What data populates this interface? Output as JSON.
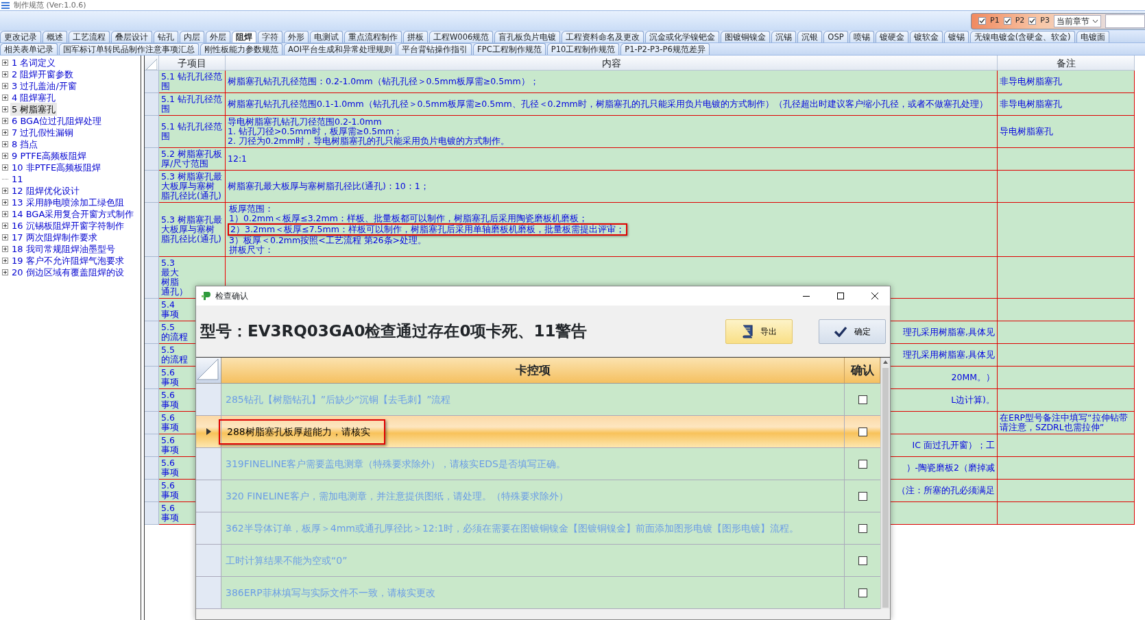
{
  "window": {
    "title": "制作规范 (Ver:1.0.6)"
  },
  "filter": {
    "options": [
      {
        "label": "P1",
        "checked": true
      },
      {
        "label": "P2",
        "checked": true
      },
      {
        "label": "P3",
        "checked": true
      }
    ],
    "scope": "当前章节"
  },
  "tab_rows": [
    [
      {
        "label": "更改记录",
        "selected": false
      },
      {
        "label": "概述",
        "selected": false
      },
      {
        "label": "工艺流程",
        "selected": false
      },
      {
        "label": "叠层设计",
        "selected": false
      },
      {
        "label": "钻孔",
        "selected": false
      },
      {
        "label": "内层",
        "selected": false
      },
      {
        "label": "外层",
        "selected": false
      },
      {
        "label": "阻焊",
        "selected": true
      },
      {
        "label": "字符",
        "selected": false
      },
      {
        "label": "外形",
        "selected": false
      },
      {
        "label": "电测试",
        "selected": false
      },
      {
        "label": "重点流程制作",
        "selected": false
      },
      {
        "label": "拼板",
        "selected": false
      },
      {
        "label": "工程W006规范",
        "selected": false
      },
      {
        "label": "盲孔板负片电镀",
        "selected": false
      },
      {
        "label": "工程资料命名及更改",
        "selected": false
      },
      {
        "label": "沉金或化学镍钯金",
        "selected": false
      },
      {
        "label": "图镀铜镍金",
        "selected": false
      },
      {
        "label": "沉锡",
        "selected": false
      },
      {
        "label": "沉银",
        "selected": false
      },
      {
        "label": "OSP",
        "selected": false
      },
      {
        "label": "喷锡",
        "selected": false
      },
      {
        "label": "镀硬金",
        "selected": false
      },
      {
        "label": "镀软金",
        "selected": false
      },
      {
        "label": "镀锡",
        "selected": false
      },
      {
        "label": "无镍电镀金(含硬金、软金)",
        "selected": false
      },
      {
        "label": "电镀面",
        "selected": false
      }
    ],
    [
      {
        "label": "相关表单记录",
        "selected": false
      },
      {
        "label": "国军标订单转民品制作注意事项汇总",
        "selected": false
      },
      {
        "label": "刚性板能力参数规范",
        "selected": false
      },
      {
        "label": "AOI平台生成和异常处理规则",
        "selected": false
      },
      {
        "label": "平台背钻操作指引",
        "selected": false
      },
      {
        "label": "FPC工程制作规范",
        "selected": false
      },
      {
        "label": "P10工程制作规范",
        "selected": false
      },
      {
        "label": "P1-P2-P3-P6规范差异",
        "selected": false
      }
    ]
  ],
  "tree": [
    {
      "label": "1  名词定义",
      "expandable": true,
      "selected": false
    },
    {
      "label": "2  阻焊开窗参数",
      "expandable": true,
      "selected": false
    },
    {
      "label": "3  过孔盖油/开窗",
      "expandable": true,
      "selected": false
    },
    {
      "label": "4  阻焊塞孔",
      "expandable": true,
      "selected": false
    },
    {
      "label": "5  树脂塞孔",
      "expandable": true,
      "selected": true
    },
    {
      "label": "6  BGA位过孔阻焊处理",
      "expandable": true,
      "selected": false
    },
    {
      "label": "7  过孔假性漏铜",
      "expandable": true,
      "selected": false
    },
    {
      "label": "8  挡点",
      "expandable": true,
      "selected": false
    },
    {
      "label": "9  PTFE高频板阻焊",
      "expandable": true,
      "selected": false
    },
    {
      "label": "10  非PTFE高频板阻焊",
      "expandable": true,
      "selected": false
    },
    {
      "label": "11",
      "expandable": false,
      "selected": false
    },
    {
      "label": "12  阻焊优化设计",
      "expandable": true,
      "selected": false
    },
    {
      "label": "13  采用静电喷涂加工绿色阻",
      "expandable": true,
      "selected": false
    },
    {
      "label": "14  BGA采用复合开窗方式制作",
      "expandable": true,
      "selected": false
    },
    {
      "label": "16  沉锡板阻焊开窗字符制作",
      "expandable": true,
      "selected": false
    },
    {
      "label": "17  两次阻焊制作要求",
      "expandable": true,
      "selected": false
    },
    {
      "label": "18  我司常规阻焊油墨型号",
      "expandable": true,
      "selected": false
    },
    {
      "label": "19  客户不允许阻焊气泡要求",
      "expandable": true,
      "selected": false
    },
    {
      "label": "20  倒边区域有覆盖阻焊的设",
      "expandable": true,
      "selected": false
    }
  ],
  "grid": {
    "columns": [
      "子项目",
      "内容",
      "备注"
    ],
    "rows": [
      {
        "subitem": "5.1 钻孔孔径范围",
        "content": "树脂塞孔钻孔孔径范围：0.2-1.0mm（钻孔孔径＞0.5mm板厚需≥0.5mm）；",
        "remark": "非导电树脂塞孔"
      },
      {
        "subitem": "5.1 钻孔孔径范围",
        "content": "树脂塞孔钻孔孔径范围0.1-1.0mm（钻孔孔径＞0.5mm板厚需≥0.5mm、孔径＜0.2mm时，树脂塞孔的孔只能采用负片电镀的方式制作）（孔径超出时建议客户缩小孔径，或者不做塞孔处理）",
        "remark": "非导电树脂塞孔"
      },
      {
        "subitem": "5.1 钻孔孔径范围",
        "content": "导电树脂塞孔钻孔刀径范围0.2-1.0mm\n1.  钻孔刀径>0.5mm时，板厚需≥0.5mm；\n2.  刀径为0.2mm时，导电树脂塞孔的孔只能采用负片电镀的方式制作。",
        "remark": "导电树脂塞孔"
      },
      {
        "subitem": "5.2 树脂塞孔板厚/尺寸范围",
        "content": "12:1"
      },
      {
        "subitem": "5.3 树脂塞孔最大板厚与塞树脂孔径比(通孔)",
        "content": "树脂塞孔最大板厚与塞树脂孔径比(通孔)：10：1；"
      },
      {
        "subitem": "5.3 树脂塞孔最大板厚与塞树脂孔径比(通孔)",
        "content": [
          {
            "text": "板厚范围：",
            "highlighted": false
          },
          {
            "text": "1）0.2mm＜板厚≤3.2mm：样板、批量板都可以制作，树脂塞孔后采用陶瓷磨板机磨板；",
            "highlighted": false
          },
          {
            "text": "2）3.2mm＜板厚≤7.5mm：样板可以制作，树脂塞孔后采用单轴磨板机磨板，批量板需提出评审；",
            "highlighted": true
          },
          {
            "text": "3）板厚＜0.2mm按照<工艺流程  第26条>处理。",
            "highlighted": false
          },
          {
            "text": "拼板尺寸：",
            "highlighted": false
          }
        ]
      },
      {
        "subitem": [
          "5.3",
          "最大",
          "树脂",
          "通孔）"
        ]
      },
      {
        "subitem": [
          "5.4",
          "事项"
        ]
      },
      {
        "subitem": [
          "5.5",
          "的流程"
        ],
        "content": "理孔采用树脂塞,具体见"
      },
      {
        "subitem": [
          "5.5",
          "的流程"
        ],
        "content": "理孔采用树脂塞,具体见"
      },
      {
        "subitem": [
          "5.6",
          "事项"
        ],
        "content": "20MM。）"
      },
      {
        "subitem": [
          "5.6",
          "事项"
        ],
        "content": "L边计算)。"
      },
      {
        "subitem": [
          "5.6",
          "事项"
        ],
        "remark": "在ERP型号备注中填写“拉伸钻带请注意，SZDRL也需拉伸”"
      },
      {
        "subitem": [
          "5.6",
          "事项"
        ],
        "content": "IC 面过孔开窗）；工"
      },
      {
        "subitem": [
          "5.6",
          "事项"
        ],
        "content": "）-陶瓷磨板2（磨掉减"
      },
      {
        "subitem": [
          "5.6",
          "事项"
        ],
        "content": "（注：所塞的孔必须满足"
      },
      {
        "subitem": [
          "5.6",
          "事项"
        ]
      }
    ]
  },
  "dialog": {
    "title": "检查确认",
    "heading": "型号：EV3RQ03GA0检查通过存在0项卡死、11警告",
    "buttons": [
      {
        "kind": "export",
        "label": "导出"
      },
      {
        "kind": "confirm",
        "label": "确定"
      }
    ],
    "columns": [
      "卡控项",
      "确认"
    ],
    "rows": [
      {
        "text": "285钻孔【树脂钻孔】”后缺少“沉铜【去毛刺】”流程",
        "selected": false,
        "highlighted": false,
        "checked": false
      },
      {
        "text": "288树脂塞孔板厚超能力，请核实",
        "selected": true,
        "highlighted": true,
        "checked": false
      },
      {
        "text": "319FINELINE客户需要盖电测章（特殊要求除外），请核实EDS是否填写正确。",
        "selected": false,
        "highlighted": false,
        "checked": false
      },
      {
        "text": "320 FINELINE客户，需加电测章，并注意提供图纸，请处理。（特殊要求除外）",
        "selected": false,
        "highlighted": false,
        "checked": false
      },
      {
        "text": "362半导体订单，板厚＞4mm或通孔厚径比＞12:1时，必须在需要在图镀铜镍金【图镀铜镍金】前面添加图形电镀【图形电镀】流程。",
        "selected": false,
        "highlighted": false,
        "checked": false
      },
      {
        "text": "工时计算结果不能为空或“0”",
        "selected": false,
        "highlighted": false,
        "checked": false
      },
      {
        "text": "386ERP菲林填写与实际文件不一致，请核实更改",
        "selected": false,
        "highlighted": false,
        "checked": false
      }
    ]
  }
}
